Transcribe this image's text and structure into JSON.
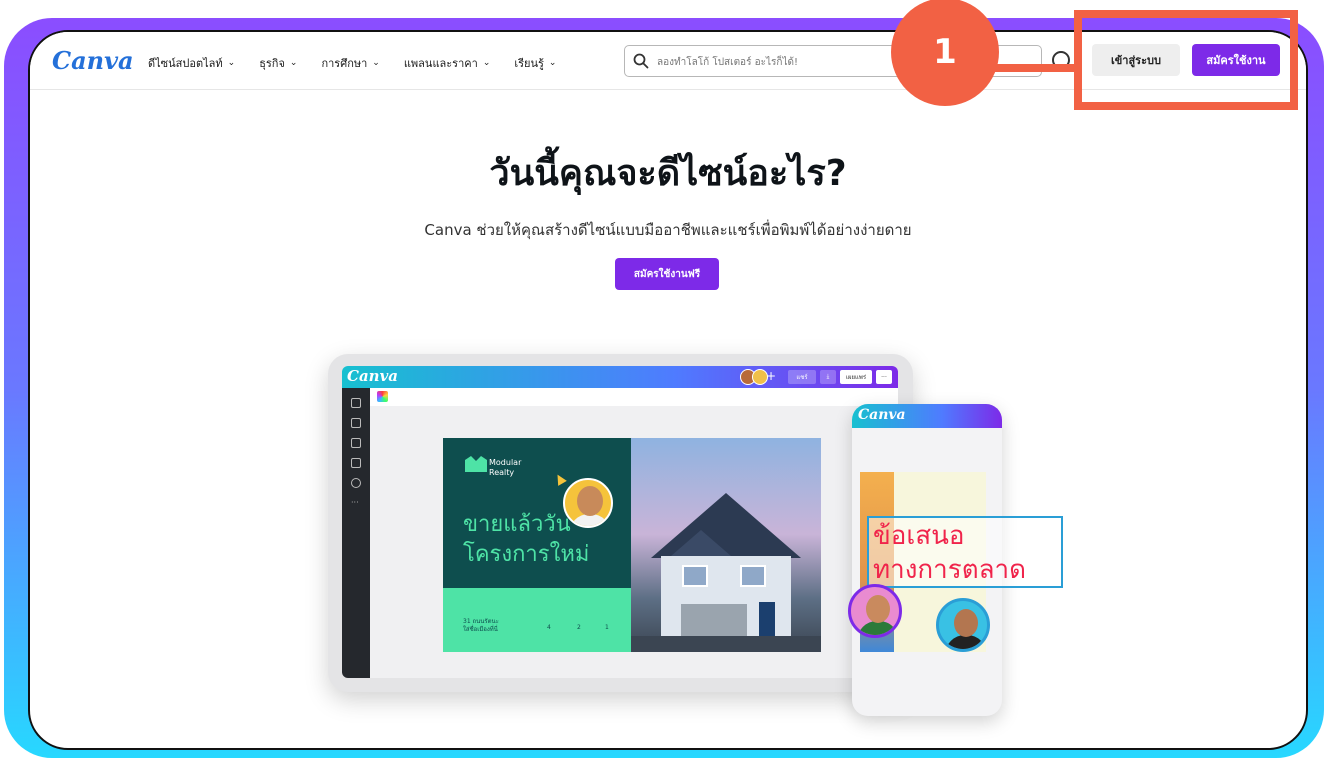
{
  "header": {
    "logo": "Canva",
    "nav": [
      {
        "label": "ดีไซน์สปอตไลท์"
      },
      {
        "label": "ธุรกิจ"
      },
      {
        "label": "การศึกษา"
      },
      {
        "label": "แพลนและราคา"
      },
      {
        "label": "เรียนรู้"
      }
    ],
    "search_placeholder": "ลองทำโลโก้ โปสเตอร์ อะไรก็ได้!",
    "login_label": "เข้าสู่ระบบ",
    "signup_label": "สมัครใช้งาน"
  },
  "hero": {
    "title": "วันนี้คุณจะดีไซน์อะไร?",
    "subtitle": "Canva ช่วยให้คุณสร้างดีไซน์แบบมืออาชีพและแชร์เพื่อพิมพ์ได้อย่างง่ายดาย",
    "cta": "สมัครใช้งานฟรี"
  },
  "mockup": {
    "tablet_logo": "Canva",
    "tablet_share": "แชร์",
    "tablet_download": "⤓",
    "tablet_publish": "เผยแพร่",
    "tablet_more": "···",
    "tablet_add": "+",
    "brand_name_1": "Modular",
    "brand_name_2": "Realty",
    "headline_1": "ขายแล้ววัน",
    "headline_2": "โครงการใหม่",
    "address_1": "31 ถนนรัตนะ",
    "address_2": "ใส่ชื่อเมืองที่นี่",
    "amenities": [
      "4",
      "2",
      "1"
    ],
    "phone_logo": "Canva",
    "offer_line_1": "ข้อเสนอ",
    "offer_line_2": "ทางการตลาด"
  },
  "annotation": {
    "step_number": "1",
    "color": "#f26144"
  },
  "colors": {
    "brand_purple": "#7d2ae8",
    "logo_blue": "#2470d9",
    "frame_top": "#8b4dff",
    "frame_bottom": "#27d8ff"
  }
}
